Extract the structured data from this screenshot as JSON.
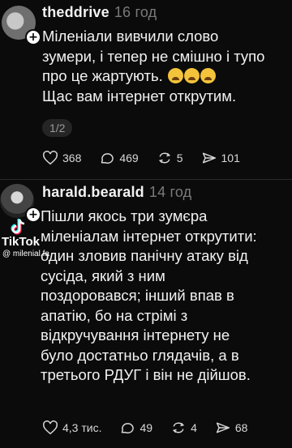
{
  "posts": [
    {
      "username": "theddrive",
      "time": "16 год",
      "text_lines": [
        "Міленіали вивчили слово",
        "зумери, і тепер не смішно і тупо",
        "про це жартують.",
        "Щас вам інтернет открутим."
      ],
      "emoji": "loudly-crying-face x3",
      "pager": "1/2",
      "likes": "368",
      "comments": "469",
      "reposts": "5",
      "shares": "101"
    },
    {
      "username": "harald.bearald",
      "time": "14 год",
      "text_lines": [
        "Пішли якось три зумєра",
        "міленіалам інтернет открутити:",
        "один зловив панічну атаку від",
        "сусіда, який з ним",
        "поздоровався; інший впав в",
        "апатію, бо на стрімі з",
        "відкручування інтернету не",
        "було достатньо глядачів, а в",
        "третього РДУГ і він не дійшов."
      ],
      "likes": "4,3 тис.",
      "comments": "49",
      "reposts": "4",
      "shares": "68"
    }
  ],
  "watermark": {
    "brand": "TikTok",
    "handle": "@ milenial.fa"
  },
  "icons": {
    "like": "heart-icon",
    "comment": "comment-bubble-icon",
    "repost": "repost-arrows-icon",
    "share": "send-icon",
    "follow": "plus-icon"
  },
  "colors": {
    "background": "#0b0b0b",
    "text": "#f2f2f2",
    "muted": "#7a7a7a"
  }
}
